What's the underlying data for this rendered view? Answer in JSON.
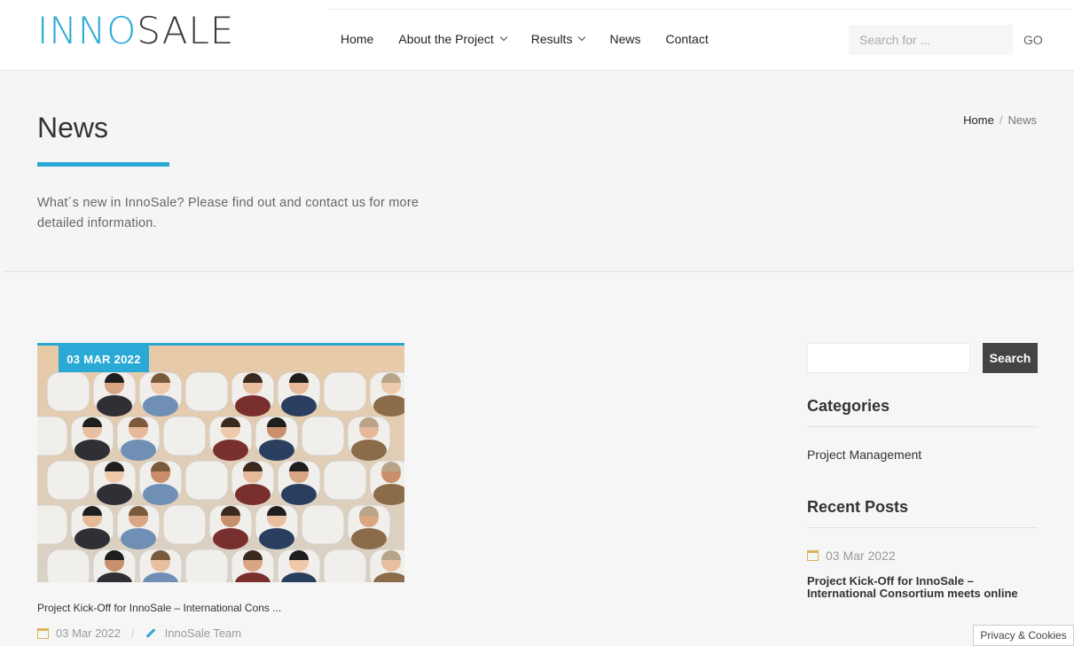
{
  "header": {
    "logo": {
      "light": "INNO",
      "dark": "SALE"
    },
    "nav": [
      {
        "label": "Home",
        "dropdown": false
      },
      {
        "label": "About the Project",
        "dropdown": true
      },
      {
        "label": "Results",
        "dropdown": true
      },
      {
        "label": "News",
        "dropdown": false
      },
      {
        "label": "Contact",
        "dropdown": false
      }
    ],
    "search_placeholder": "Search for ...",
    "go_label": "GO"
  },
  "title_band": {
    "title": "News",
    "description": "What´s new in InnoSale? Please find out and contact us for more detailed information.",
    "breadcrumb": {
      "home": "Home",
      "separator": "/",
      "current": "News"
    }
  },
  "post": {
    "date_badge": "03 MAR 2022",
    "title": "Project Kick-Off for InnoSale – International Cons ...",
    "date": "03 Mar 2022",
    "meta_separator": "/",
    "author": "InnoSale Team",
    "image_icon": "group-video-call-photo"
  },
  "sidebar": {
    "search_button": "Search",
    "categories_title": "Categories",
    "categories": [
      "Project Management"
    ],
    "recent_title": "Recent Posts",
    "recent_date": "03 Mar 2022",
    "recent_link": "Project Kick-Off for InnoSale – International Consortium meets online"
  },
  "cookie_label": "Privacy & Cookies",
  "colors": {
    "accent": "#2aa9d6",
    "dark": "#3a3a3a"
  }
}
